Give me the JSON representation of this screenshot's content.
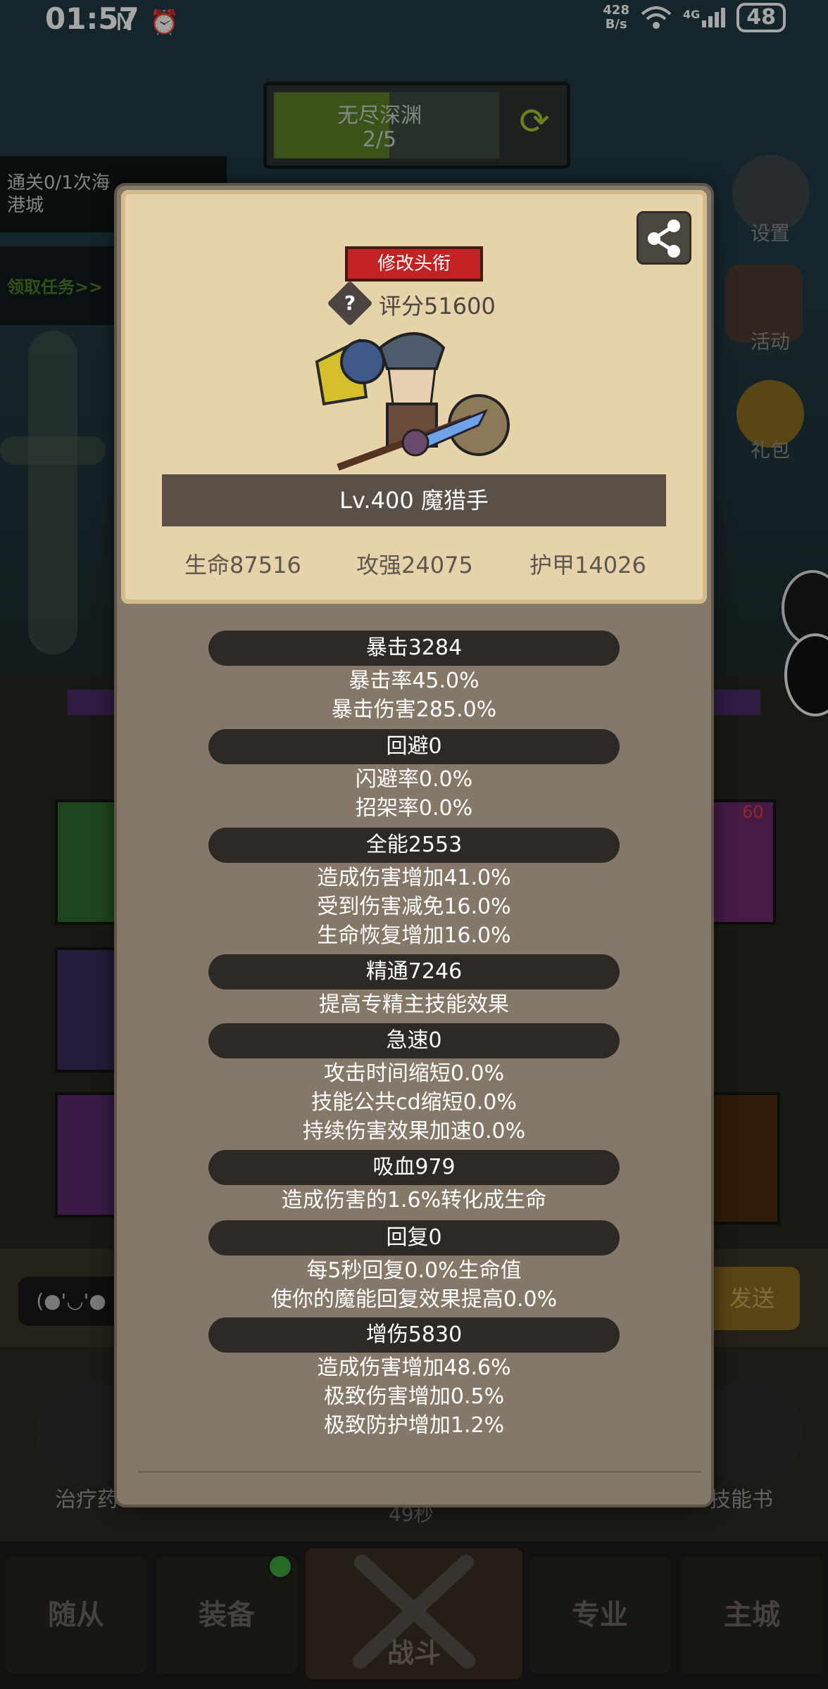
{
  "status_bar": {
    "time": "01:57",
    "left_icons": "N ⏰",
    "net_speed_value": "428",
    "net_speed_unit": "B/s",
    "network": "4G",
    "battery": "48"
  },
  "background": {
    "abyss_title": "无尽深渊",
    "abyss_progress": "2/5",
    "quest_text_line1": "通关0/1次海",
    "quest_text_line2": "港城",
    "quest_claim": "领取任务>>",
    "side_settings": "设置",
    "side_activity": "活动",
    "side_gift": "礼包",
    "chat_emote": "(●'◡'●",
    "send_label": "发送",
    "timer_text": "49秒",
    "left_item_label": "治疗药",
    "right_item_label": "技能书",
    "badge_60": "60"
  },
  "bottom_nav": {
    "followers": "随从",
    "equipment": "装备",
    "battle": "战斗",
    "profession": "专业",
    "main_city": "主城"
  },
  "profile": {
    "edit_title_button": "修改头衔",
    "score": "评分51600",
    "help": "?",
    "name": "Lv.400 魔猎手",
    "hp": "生命87516",
    "attack": "攻强24075",
    "armor": "护甲14026"
  },
  "stats": [
    {
      "title": "暴击3284",
      "lines": [
        "暴击率45.0%",
        "暴击伤害285.0%"
      ]
    },
    {
      "title": "回避0",
      "lines": [
        "闪避率0.0%",
        "招架率0.0%"
      ]
    },
    {
      "title": "全能2553",
      "lines": [
        "造成伤害增加41.0%",
        "受到伤害减免16.0%",
        "生命恢复增加16.0%"
      ]
    },
    {
      "title": "精通7246",
      "lines": [
        "提高专精主技能效果"
      ]
    },
    {
      "title": "急速0",
      "lines": [
        "攻击时间缩短0.0%",
        "技能公共cd缩短0.0%",
        "持续伤害效果加速0.0%"
      ]
    },
    {
      "title": "吸血979",
      "lines": [
        "造成伤害的1.6%转化成生命"
      ]
    },
    {
      "title": "回复0",
      "lines": [
        "每5秒回复0.0%生命值",
        "使你的魔能回复效果提高0.0%"
      ]
    },
    {
      "title": "增伤5830",
      "lines": [
        "造成伤害增加48.6%",
        "极致伤害增加0.5%",
        "极致防护增加1.2%"
      ]
    }
  ]
}
